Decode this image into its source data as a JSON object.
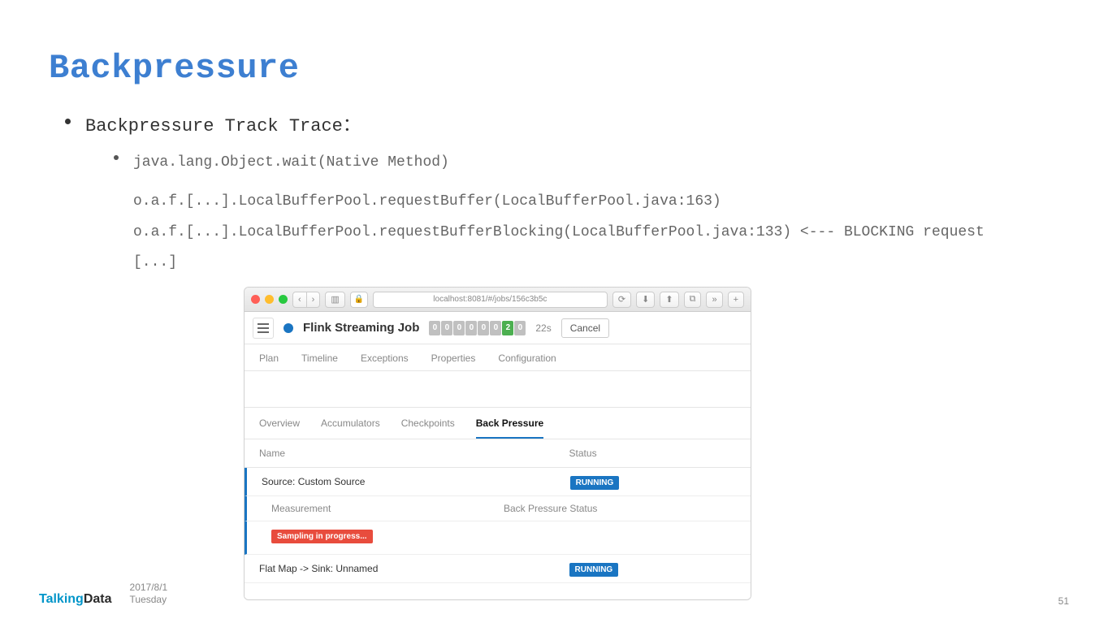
{
  "title": "Backpressure",
  "bullet1": "Backpressure Track Trace：",
  "trace": {
    "l1": "java.lang.Object.wait(Native Method)",
    "l2": "o.a.f.[...].LocalBufferPool.requestBuffer(LocalBufferPool.java:163)",
    "l3": "o.a.f.[...].LocalBufferPool.requestBufferBlocking(LocalBufferPool.java:133) <--- BLOCKING request",
    "l4": "[...]"
  },
  "browser": {
    "url": "localhost:8081/#/jobs/156c3b5c",
    "job_title": "Flink Streaming Job",
    "counters": [
      "0",
      "0",
      "0",
      "0",
      "0",
      "0",
      "2",
      "0"
    ],
    "duration": "22s",
    "cancel": "Cancel",
    "main_tabs": [
      "Plan",
      "Timeline",
      "Exceptions",
      "Properties",
      "Configuration"
    ],
    "sub_tabs": [
      "Overview",
      "Accumulators",
      "Checkpoints",
      "Back Pressure"
    ],
    "thead": {
      "name": "Name",
      "status": "Status"
    },
    "rows": {
      "r1_name": "Source: Custom Source",
      "r1_status": "RUNNING",
      "sub_measure": "Measurement",
      "sub_bp": "Back Pressure Status",
      "sampling": "Sampling in progress...",
      "r2_name": "Flat Map -> Sink: Unnamed",
      "r2_status": "RUNNING"
    }
  },
  "footer": {
    "brand1": "Talking",
    "brand2": "Data",
    "date1": "2017/8/1",
    "date2": "Tuesday",
    "page": "51"
  }
}
